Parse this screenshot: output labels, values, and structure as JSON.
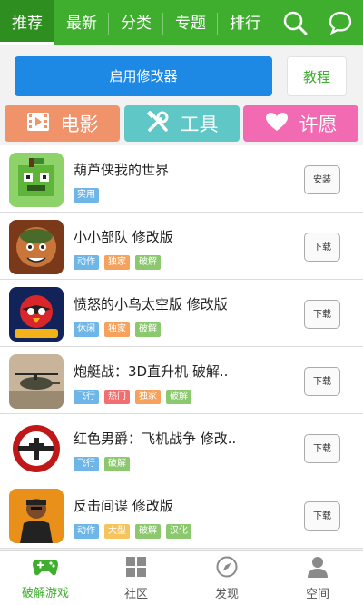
{
  "top_tabs": [
    "推荐",
    "最新",
    "分类",
    "专题",
    "排行"
  ],
  "top_icons": [
    "search-icon",
    "chat-bubble-icon"
  ],
  "actions": {
    "modifier_label": "启用修改器",
    "guide_label": "教程"
  },
  "categories": [
    {
      "label": "电影",
      "icon": "film-icon",
      "color": "#f0926a"
    },
    {
      "label": "工具",
      "icon": "tools-icon",
      "color": "#5fc7c5"
    },
    {
      "label": "许愿",
      "icon": "heart-icon",
      "color": "#f26ab2"
    }
  ],
  "apps": [
    {
      "name": "葫芦侠我的世界",
      "tags": [
        "实用"
      ],
      "button": "安装"
    },
    {
      "name": "小小部队  修改版",
      "tags": [
        "动作",
        "独家",
        "破解"
      ],
      "button": "下载"
    },
    {
      "name": "愤怒的小鸟太空版  修改版",
      "tags": [
        "休闲",
        "独家",
        "破解"
      ],
      "button": "下载"
    },
    {
      "name": "炮艇战：3D直升机  破解..",
      "tags": [
        "飞行",
        "热门",
        "独家",
        "破解"
      ],
      "button": "下载"
    },
    {
      "name": "红色男爵：飞机战争  修改..",
      "tags": [
        "飞行",
        "破解"
      ],
      "button": "下载"
    },
    {
      "name": "反击间谍    修改版",
      "tags": [
        "动作",
        "大型",
        "破解",
        "汉化"
      ],
      "button": "下载"
    }
  ],
  "tag_colors": {
    "实用": "#6fb6e8",
    "动作": "#6fb6e8",
    "休闲": "#6fb6e8",
    "飞行": "#6fb6e8",
    "独家": "#f6a15c",
    "热门": "#f26f6f",
    "大型": "#f6c45c",
    "破解": "#8cc86e",
    "汉化": "#8cc86e"
  },
  "bottom_nav": [
    {
      "label": "破解游戏",
      "icon": "gamepad-icon",
      "active": true
    },
    {
      "label": "社区",
      "icon": "grid-icon",
      "active": false
    },
    {
      "label": "发现",
      "icon": "compass-icon",
      "active": false
    },
    {
      "label": "空间",
      "icon": "user-icon",
      "active": false
    }
  ],
  "colors": {
    "brand_green": "#3fae2e",
    "button_blue": "#1e88e5"
  }
}
